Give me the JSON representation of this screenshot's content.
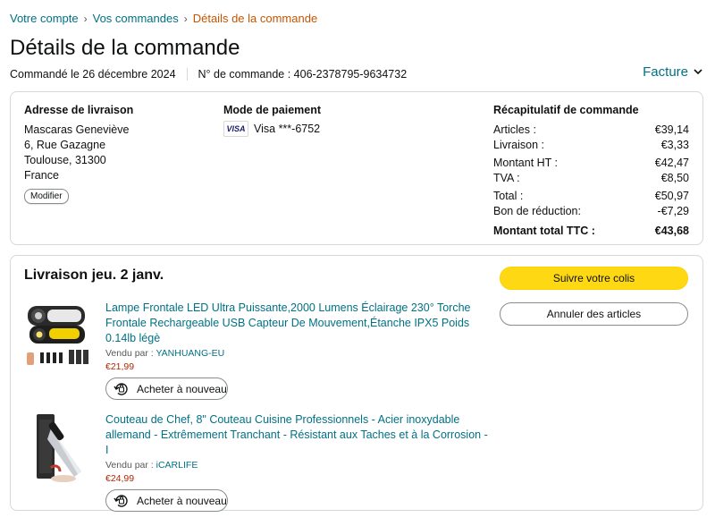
{
  "breadcrumb": {
    "items": [
      "Votre compte",
      "Vos commandes"
    ],
    "separator": "›",
    "current": "Détails de la commande"
  },
  "page": {
    "title": "Détails de la commande"
  },
  "order": {
    "date_text": "Commandé le 26 décembre 2024",
    "number_text": "N° de commande : 406-2378795-9634732",
    "invoice_label": "Facture"
  },
  "shipping": {
    "title": "Adresse de livraison",
    "lines": [
      "Mascaras Geneviève",
      "6, Rue Gazagne",
      "Toulouse, 31300",
      "France"
    ],
    "modify_label": "Modifier"
  },
  "payment": {
    "title": "Mode de paiement",
    "card_brand": "VISA",
    "card_text": "Visa ***-6752"
  },
  "summary": {
    "title": "Récapitulatif de commande",
    "rows": [
      {
        "label": "Articles :",
        "value": "€39,14"
      },
      {
        "label": "Livraison :",
        "value": "€3,33"
      },
      {
        "label": "Montant HT :",
        "value": "€42,47"
      },
      {
        "label": "TVA :",
        "value": "€8,50"
      },
      {
        "label": "Total :",
        "value": "€50,97"
      },
      {
        "label": "Bon de réduction:",
        "value": "-€7,29"
      }
    ],
    "grand_total": {
      "label": "Montant total TTC :",
      "value": "€43,68"
    }
  },
  "shipment": {
    "title": "Livraison jeu. 2 janv.",
    "track_label": "Suivre votre colis",
    "cancel_label": "Annuler des articles",
    "products": [
      {
        "title": "Lampe Frontale LED Ultra Puissante,2000 Lumens Éclairage 230° Torche Frontale Rechargeable USB Capteur De Mouvement,Étanche IPX5 Poids 0.14lb légè",
        "seller_prefix": "Vendu par :",
        "seller_name": "YANHUANG-EU",
        "price": "€21,99",
        "rebuy_label": "Acheter à nouveau"
      },
      {
        "title": "Couteau de Chef, 8\" Couteau Cuisine Professionnels - Acier inoxydable allemand - Extrêmement Tranchant - Résistant aux Taches et à la Corrosion - I",
        "seller_prefix": "Vendu par :",
        "seller_name": "iCARLIFE",
        "price": "€24,99",
        "rebuy_label": "Acheter à nouveau"
      }
    ]
  },
  "colors": {
    "link": "#007185",
    "breadcrumb_current": "#c45500",
    "price": "#b12704",
    "primary_button": "#ffd814",
    "border": "#d5d9d9"
  }
}
